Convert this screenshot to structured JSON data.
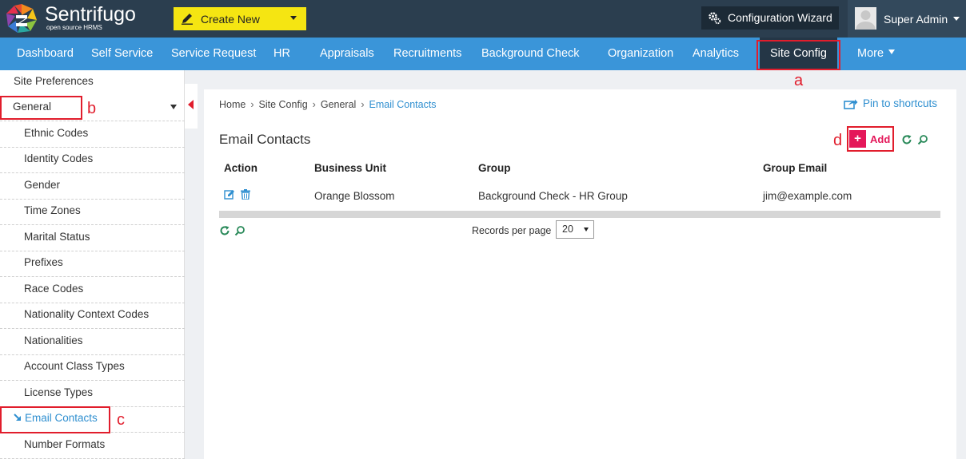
{
  "header": {
    "brand": "Sentrifugo",
    "brand_tagline": "open source HRMS",
    "create_new": "Create New",
    "configuration_wizard": "Configuration Wizard",
    "user_name": "Super Admin"
  },
  "nav": {
    "items": [
      "Dashboard",
      "Self Service",
      "Service Request",
      "HR",
      "Appraisals",
      "Recruitments",
      "Background Check",
      "Organization",
      "Analytics",
      "Site Config",
      "More"
    ],
    "active": "Site Config"
  },
  "annotations": {
    "a": "a",
    "b": "b",
    "c": "c",
    "d": "d"
  },
  "sidebar": {
    "top": "Site Preferences",
    "group": "General",
    "items": [
      "Ethnic Codes",
      "Identity Codes",
      "Gender",
      "Time Zones",
      "Marital Status",
      "Prefixes",
      "Race Codes",
      "Nationality Context Codes",
      "Nationalities",
      "Account Class Types",
      "License Types",
      "Email Contacts",
      "Number Formats"
    ],
    "active": "Email Contacts"
  },
  "breadcrumb": [
    "Home",
    "Site Config",
    "General",
    "Email Contacts"
  ],
  "pin_label": "Pin to shortcuts",
  "page_title": "Email Contacts",
  "add_label": "Add",
  "table": {
    "headers": [
      "Action",
      "Business Unit",
      "Group",
      "Group Email"
    ],
    "rows": [
      {
        "business_unit": "Orange Blossom",
        "group": "Background Check - HR Group",
        "group_email": "jim@example.com"
      }
    ]
  },
  "pagination": {
    "records_per_page_label": "Records per page",
    "records_per_page": "20"
  },
  "colors": {
    "topbar": "#2b3e4f",
    "nav": "#3a95d9",
    "nav_active": "#243646",
    "create_new": "#f5e512",
    "accent_link": "#2f8fd0",
    "add_button": "#e4185a",
    "highlight": "#e11d2c"
  },
  "icons": [
    "logo-icon",
    "pen-icon",
    "gear-icon",
    "avatar-icon",
    "pin-icon",
    "edit-icon",
    "delete-icon",
    "refresh-icon",
    "search-icon",
    "arrow-icon"
  ]
}
